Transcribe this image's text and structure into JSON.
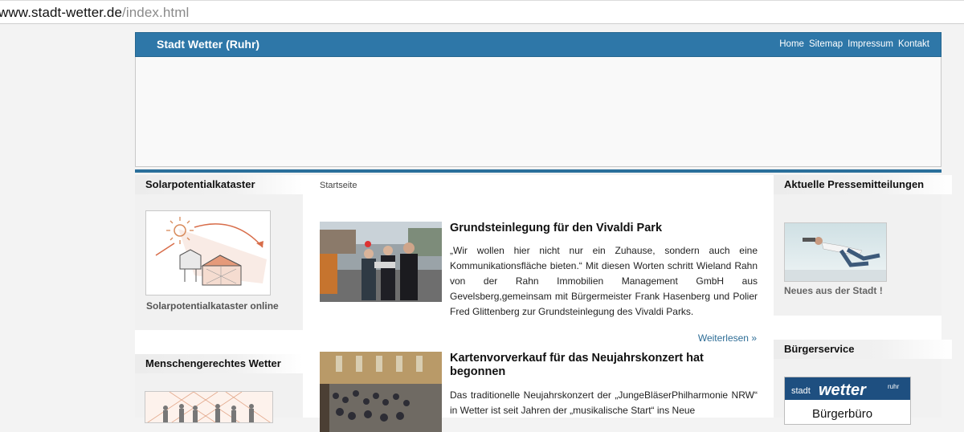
{
  "browser": {
    "url_host": "www.stadt-wetter.de",
    "url_path": "/index.html"
  },
  "header": {
    "site_title": "Stadt Wetter (Ruhr)",
    "nav": [
      "Home",
      "Sitemap",
      "Impressum",
      "Kontakt"
    ]
  },
  "left_sidebar": {
    "box1": {
      "title": "Solarpotentialkataster",
      "caption": "Solarpotentialkataster online"
    },
    "box2": {
      "title": "Menschengerechtes Wetter"
    }
  },
  "main": {
    "breadcrumb": "Startseite",
    "articles": [
      {
        "title": "Grundsteinlegung für den Vivaldi Park",
        "text": "„Wir wollen hier nicht nur ein Zuhause, sondern auch eine Kommunikationsfläche bieten.“ Mit diesen Worten schritt Wieland Rahn von der Rahn Immobilien Management GmbH aus Gevelsberg,gemeinsam mit Bürgermeister Frank Hasenberg und Polier Fred Glittenberg zur Grundsteinlegung des Vivaldi Parks.",
        "readmore": "Weiterlesen »"
      },
      {
        "title": "Kartenvorverkauf für das Neujahrskonzert hat begonnen",
        "text": "Das traditionelle Neujahrskonzert der „JungeBläserPhilharmonie NRW“ in Wetter ist seit Jahren der „musikalische Start“ ins Neue"
      }
    ]
  },
  "right_sidebar": {
    "box1": {
      "title": "Aktuelle Pressemitteilungen",
      "caption": "Neues aus der Stadt !"
    },
    "box2": {
      "title": "Bürgerservice",
      "logo_text_1": "stadt",
      "logo_text_2": "wetter",
      "logo_text_3": "ruhr",
      "logo_sub": "Bürgerbüro"
    }
  },
  "colors": {
    "header_blue": "#2e77a8",
    "divider_blue": "#2a6f9b",
    "link_blue": "#2e6d96"
  }
}
